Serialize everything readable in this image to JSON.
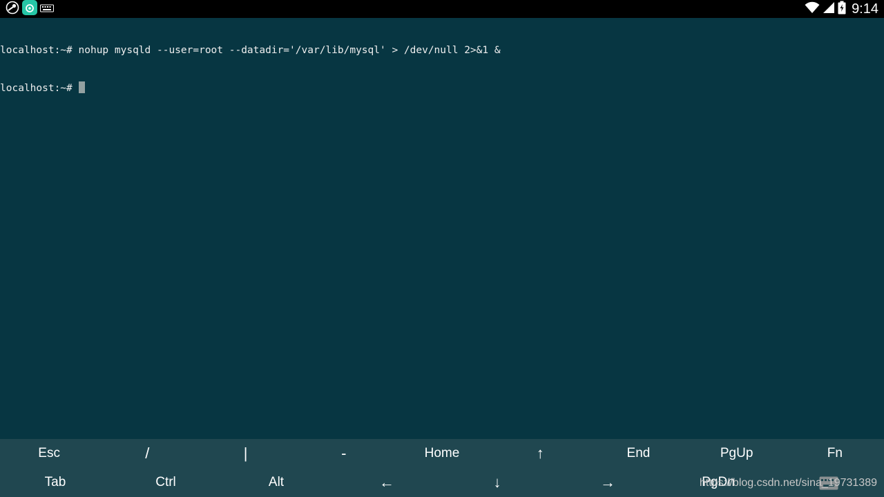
{
  "status_bar": {
    "clock": "9:14",
    "left_icons": [
      "steam-icon",
      "app-store-icon",
      "keyboard-icon"
    ],
    "right_icons": [
      "wifi-icon",
      "signal-icon",
      "battery-icon"
    ]
  },
  "terminal": {
    "lines": [
      {
        "prompt": "localhost:~# ",
        "command": "nohup mysqld --user=root --datadir='/var/lib/mysql' > /dev/null 2>&1 &"
      },
      {
        "prompt": "localhost:~# ",
        "command": ""
      }
    ]
  },
  "extra_keys": {
    "row1": [
      "Esc",
      "/",
      "|",
      "-",
      "Home",
      "↑",
      "End",
      "PgUp",
      "Fn"
    ],
    "row2": [
      "Tab",
      "Ctrl",
      "Alt",
      "←",
      "↓",
      "→",
      "PgDn"
    ]
  },
  "watermark": "https://blog.csdn.net/sina_19731389",
  "colors": {
    "terminal_bg": "#073642",
    "extra_keys_bg": "#204750",
    "status_bar_bg": "#000000",
    "cursor": "#93a1a1"
  }
}
